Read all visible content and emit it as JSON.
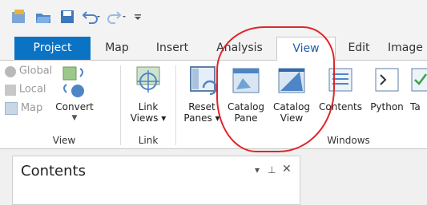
{
  "tabs": [
    {
      "label": "Project"
    },
    {
      "label": "Map"
    },
    {
      "label": "Insert"
    },
    {
      "label": "Analysis"
    },
    {
      "label": "View"
    },
    {
      "label": "Edit"
    },
    {
      "label": "Image"
    }
  ],
  "view_group": {
    "label": "View",
    "global_label": "Global",
    "local_label": "Local",
    "map_label": "Map",
    "convert_label": "Convert"
  },
  "link_group": {
    "label": "Link",
    "link_views_label_1": "Link",
    "link_views_label_2": "Views ▾"
  },
  "windows_group": {
    "label": "Windows",
    "reset_label_1": "Reset",
    "reset_label_2": "Panes ▾",
    "catalog_pane_1": "Catalog",
    "catalog_pane_2": "Pane",
    "catalog_view_1": "Catalog",
    "catalog_view_2": "View",
    "contents_label": "Contents",
    "python_label": "Python",
    "tasks_label": "Ta"
  },
  "contents_pane": {
    "title": "Contents"
  },
  "colors": {
    "project_tab": "#0b73c4",
    "annotation_red": "#e0242a"
  }
}
